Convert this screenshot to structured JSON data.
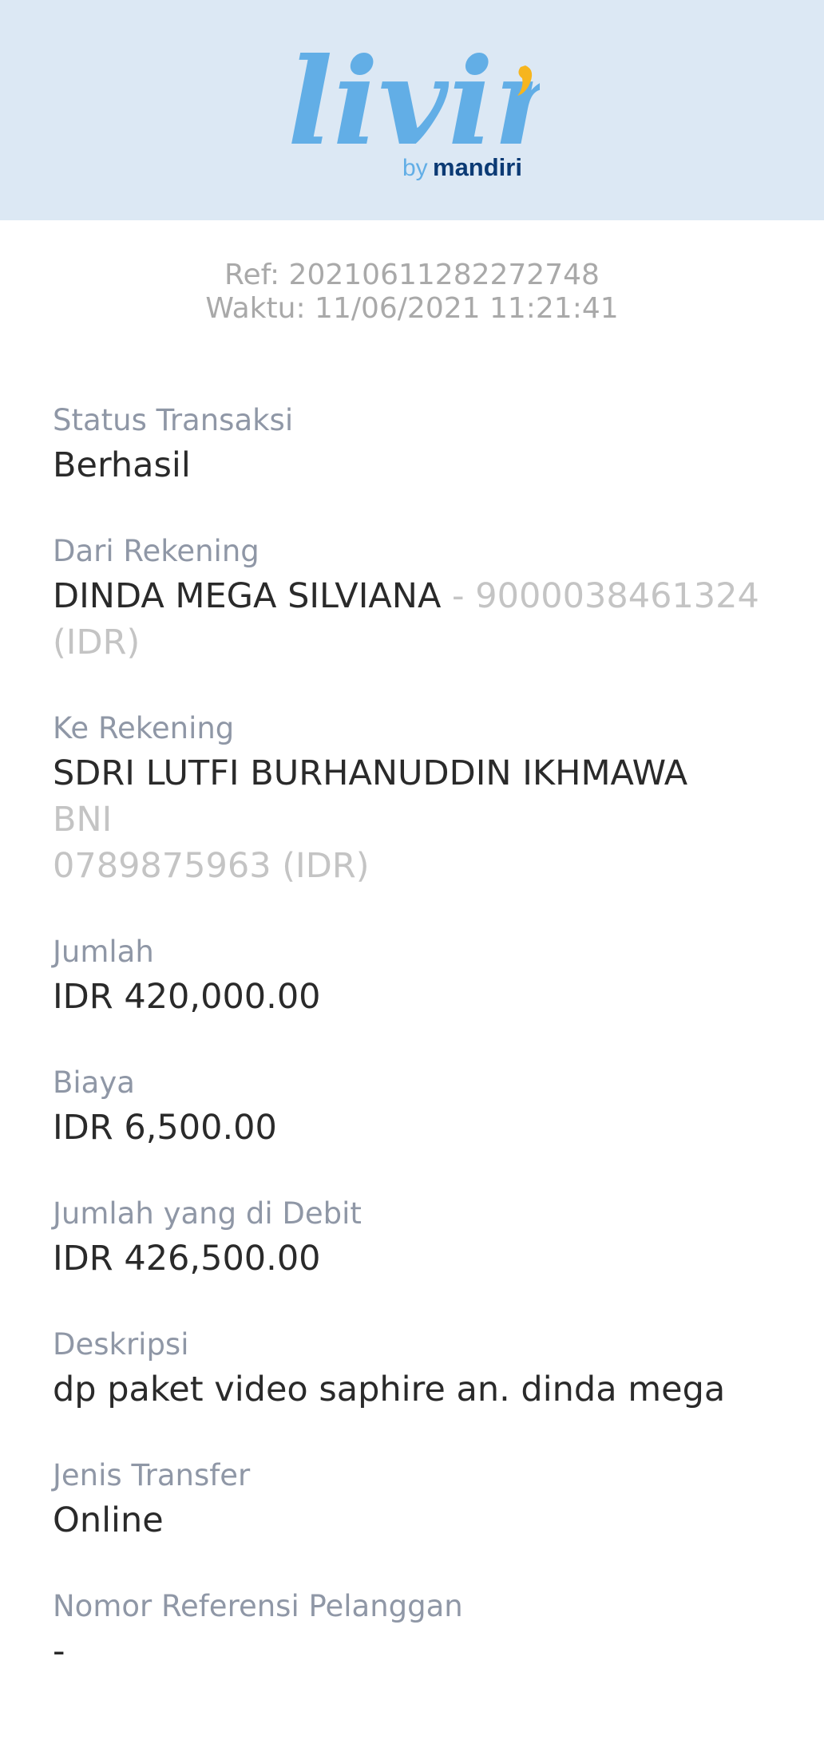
{
  "header": {
    "brand": "livin'",
    "brand_by": "by",
    "brand_name": "mandiri",
    "colors": {
      "background": "#dce8f4",
      "logo_blue": "#62aee6",
      "apostrophe": "#f6b51e",
      "mandiri_navy": "#0b3a74"
    }
  },
  "meta": {
    "ref": "Ref: 20210611282272748",
    "waktu": "Waktu: 11/06/2021 11:21:41"
  },
  "fields": {
    "status": {
      "label": "Status Transaksi",
      "value": "Berhasil"
    },
    "dari": {
      "label": "Dari Rekening",
      "name": "DINDA MEGA SILVIANA",
      "detail": " - 9000038461324 (IDR)"
    },
    "ke": {
      "label": "Ke Rekening",
      "name": "SDRI LUTFI BURHANUDDIN IKHMAWA",
      "bank": "BNI",
      "account": "0789875963 (IDR)"
    },
    "jumlah": {
      "label": "Jumlah",
      "value": "IDR 420,000.00"
    },
    "biaya": {
      "label": "Biaya",
      "value": "IDR 6,500.00"
    },
    "debit": {
      "label": "Jumlah yang di Debit",
      "value": "IDR 426,500.00"
    },
    "deskripsi": {
      "label": "Deskripsi",
      "value": "dp paket video saphire an. dinda mega"
    },
    "jenis": {
      "label": "Jenis Transfer",
      "value": "Online"
    },
    "nomor_ref": {
      "label": "Nomor Referensi Pelanggan",
      "value": "-"
    }
  }
}
